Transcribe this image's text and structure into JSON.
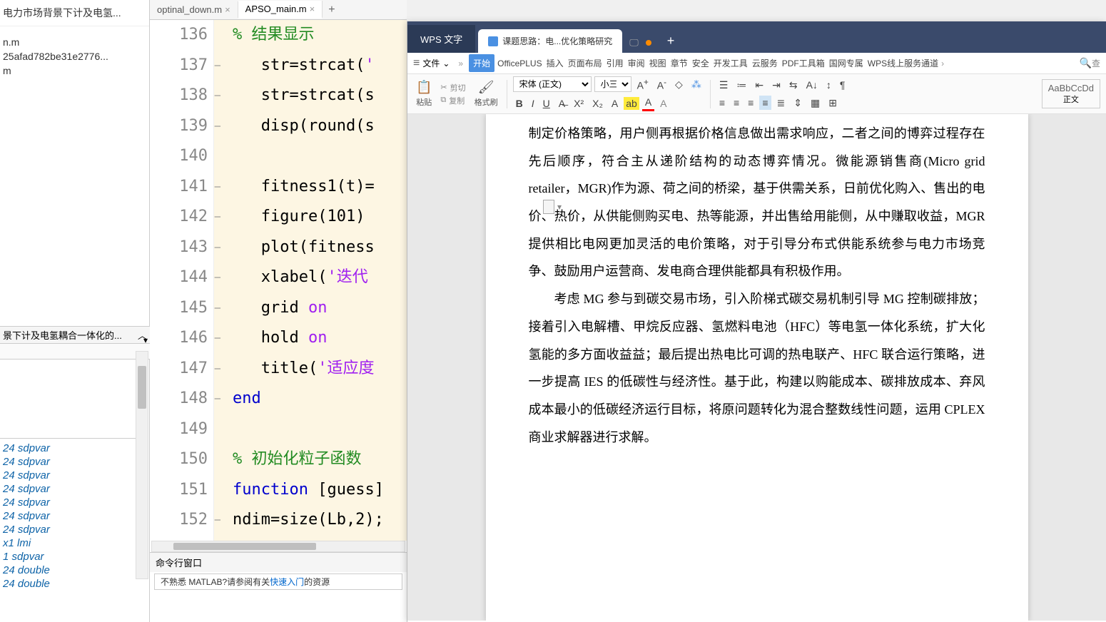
{
  "matlab": {
    "sidebar": {
      "title_truncated": "电力市场背景下计及电氢...",
      "files": [
        "",
        "",
        "n.m",
        "25afad782be31e2776...",
        "m"
      ],
      "collapse_label": "景下计及电氢耦合一体化的...",
      "vars": [
        "24 sdpvar",
        "24 sdpvar",
        "24 sdpvar",
        "24 sdpvar",
        "24 sdpvar",
        "24 sdpvar",
        "24 sdpvar",
        "x1 lmi",
        "1 sdpvar",
        "24 double",
        "24 double"
      ]
    },
    "tabs": {
      "inactive": "optinal_down.m",
      "active": "APSO_main.m"
    },
    "code": {
      "start": 136,
      "lines": [
        {
          "n": 136,
          "dash": false,
          "html": "<span class='kw-comment'>% 结果显示</span>"
        },
        {
          "n": 137,
          "dash": true,
          "html": "   <span class='kw-black'>str=strcat(</span><span class='kw-str'>'</span>"
        },
        {
          "n": 138,
          "dash": true,
          "html": "   <span class='kw-black'>str=strcat(s</span>"
        },
        {
          "n": 139,
          "dash": true,
          "html": "   <span class='kw-black'>disp(round(s</span>"
        },
        {
          "n": 140,
          "dash": false,
          "html": ""
        },
        {
          "n": 141,
          "dash": true,
          "html": "   <span class='kw-black'>fitness1(t)=</span>"
        },
        {
          "n": 142,
          "dash": true,
          "html": "   <span class='kw-black'>figure(101)</span>"
        },
        {
          "n": 143,
          "dash": true,
          "html": "   <span class='kw-black'>plot(fitness</span>"
        },
        {
          "n": 144,
          "dash": true,
          "html": "   <span class='kw-black'>xlabel(</span><span class='kw-str'>'迭代</span>"
        },
        {
          "n": 145,
          "dash": true,
          "html": "   <span class='kw-black'>grid </span><span class='kw-purple'>on</span>"
        },
        {
          "n": 146,
          "dash": true,
          "html": "   <span class='kw-black'>hold </span><span class='kw-purple'>on</span>"
        },
        {
          "n": 147,
          "dash": true,
          "html": "   <span class='kw-black'>title(</span><span class='kw-str'>'适应度</span>"
        },
        {
          "n": 148,
          "dash": true,
          "html": "<span class='kw-blue'>end</span>"
        },
        {
          "n": 149,
          "dash": false,
          "html": ""
        },
        {
          "n": 150,
          "dash": false,
          "html": "<span class='kw-comment'>% 初始化粒子函数</span>"
        },
        {
          "n": 151,
          "dash": false,
          "html": "<span class='kw-blue'>function</span> <span class='kw-black'>[guess]</span>"
        },
        {
          "n": 152,
          "dash": true,
          "html": "<span class='kw-black'>ndim=size(Lb,2);</span>"
        }
      ]
    },
    "cmdwin_label": "命令行窗口",
    "cmdprompt_pre": "不熟悉 MATLAB?请参阅有关",
    "cmdprompt_link": "快速入门",
    "cmdprompt_post": "的资源"
  },
  "wps": {
    "app_label": "WPS 文字",
    "doc_tab": "课题思路：电...优化策略研究",
    "file_label": "文件",
    "menu": [
      "开始",
      "OfficePLUS",
      "插入",
      "页面布局",
      "引用",
      "审阅",
      "视图",
      "章节",
      "安全",
      "开发工具",
      "云服务",
      "PDF工具箱",
      "国网专属",
      "WPS线上服务通道"
    ],
    "toolbar": {
      "paste": "粘贴",
      "cut": "剪切",
      "copy": "复制",
      "format_painter": "格式刷",
      "font": "宋体 (正文)",
      "size": "小三",
      "style_preview": "AaBbCcDd",
      "style_name": "正文"
    },
    "doc_text": {
      "p1": "制定价格策略，用户侧再根据价格信息做出需求响应，二者之间的博弈过程存在先后顺序，符合主从递阶结构的动态博弈情况。微能源销售商(Micro grid retailer，MGR)作为源、荷之间的桥梁，基于供需关系，日前优化购入、售出的电价、热价，从供能侧购买电、热等能源，并出售给用能侧，从中赚取收益，MGR 提供相比电网更加灵活的电价策略，对于引导分布式供能系统参与电力市场竞争、鼓励用户运营商、发电商合理供能都具有积极作用。",
      "p2": "考虑 MG 参与到碳交易市场，引入阶梯式碳交易机制引导 MG 控制碳排放；接着引入电解槽、甲烷反应器、氢燃料电池（HFC）等电氢一体化系统，扩大化氢能的多方面收益益；最后提出热电比可调的热电联产、HFC 联合运行策略，进一步提高 IES 的低碳性与经济性。基于此，构建以购能成本、碳排放成本、弃风成本最小的低碳经济运行目标，将原问题转化为混合整数线性问题，运用 CPLEX 商业求解器进行求解。"
    }
  }
}
